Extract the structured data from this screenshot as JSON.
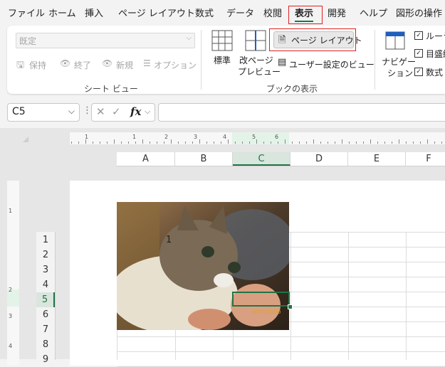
{
  "menu": {
    "items": [
      "ファイル",
      "ホーム",
      "挿入",
      "ページ レイアウト",
      "数式",
      "データ",
      "校閲",
      "表示",
      "開発",
      "ヘルプ",
      "図形の操作"
    ],
    "active": "表示"
  },
  "ribbon": {
    "sheet_view": {
      "dropdown_value": "既定",
      "keep": "保持",
      "exit": "終了",
      "new": "新規",
      "options": "オプション",
      "group_label": "シート ビュー"
    },
    "workbook_views": {
      "normal": "標準",
      "page_break_1": "改ページ",
      "page_break_2": "プレビュー",
      "page_layout": "ページ レイアウト",
      "custom_views": "ユーザー設定のビュー",
      "group_label": "ブックの表示"
    },
    "navigation_1": "ナビゲー",
    "navigation_2": "ション",
    "show": [
      "ルーラ",
      "目盛線",
      "数式"
    ]
  },
  "formula_bar": {
    "name_box": "C5",
    "fx": "fx",
    "formula": ""
  },
  "sheet": {
    "columns": [
      "A",
      "B",
      "C",
      "D",
      "E",
      "F"
    ],
    "rows": [
      "1",
      "2",
      "3",
      "4",
      "5",
      "6",
      "7",
      "8",
      "9"
    ],
    "selected_cell": "C5",
    "cell_text": "1",
    "photo_date": "2017/10/30",
    "ruler_h": [
      "1",
      "1",
      "2",
      "3",
      "4",
      "5",
      "6"
    ],
    "ruler_v": [
      "1",
      "2",
      "3",
      "4"
    ]
  },
  "colors": {
    "accent": "#217346",
    "highlight_box": "#e02020"
  }
}
